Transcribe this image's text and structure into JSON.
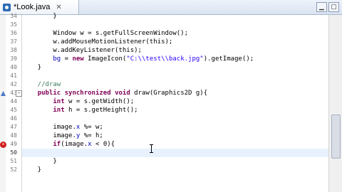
{
  "tab": {
    "label": "*Look.java",
    "close": "✕"
  },
  "window_controls": {
    "minimize": "▁",
    "maximize": "▢"
  },
  "lines": [
    {
      "num": "34",
      "text": "        }"
    },
    {
      "num": "35",
      "text": ""
    },
    {
      "num": "36",
      "text": "        Window w = s.getFullScreenWindow();"
    },
    {
      "num": "37",
      "text": "        w.addMouseMotionListener(this);"
    },
    {
      "num": "38",
      "text": "        w.addKeyListener(this);"
    },
    {
      "num": "39",
      "text": "        bg = new ImageIcon(\"C:\\\\test\\\\back.jpg\").getImage();"
    },
    {
      "num": "40",
      "text": "    }"
    },
    {
      "num": "41",
      "text": ""
    },
    {
      "num": "42",
      "text": "    //draw"
    },
    {
      "num": "43",
      "text": "    public synchronized void draw(Graphics2D g){"
    },
    {
      "num": "44",
      "text": "        int w = s.getWidth();"
    },
    {
      "num": "45",
      "text": "        int h = s.getHeight();"
    },
    {
      "num": "46",
      "text": ""
    },
    {
      "num": "47",
      "text": "        image.x %= w;"
    },
    {
      "num": "48",
      "text": "        image.y %= h;"
    },
    {
      "num": "49",
      "text": "        if(image.x < 0){"
    },
    {
      "num": "50",
      "text": ""
    },
    {
      "num": "51",
      "text": "        }"
    },
    {
      "num": "52",
      "text": "    }"
    }
  ],
  "gutter_numbers": [
    "34",
    "35",
    "36",
    "37",
    "38",
    "39",
    "40",
    "41",
    "42",
    "43",
    "44",
    "45",
    "46",
    "47",
    "48",
    "49",
    "50",
    "51",
    "52"
  ],
  "colors": {
    "keyword": "#7f0055",
    "field": "#0000c0",
    "comment": "#3f7f5f",
    "string": "#2a00ff",
    "current_line": "#e8f2fe"
  }
}
